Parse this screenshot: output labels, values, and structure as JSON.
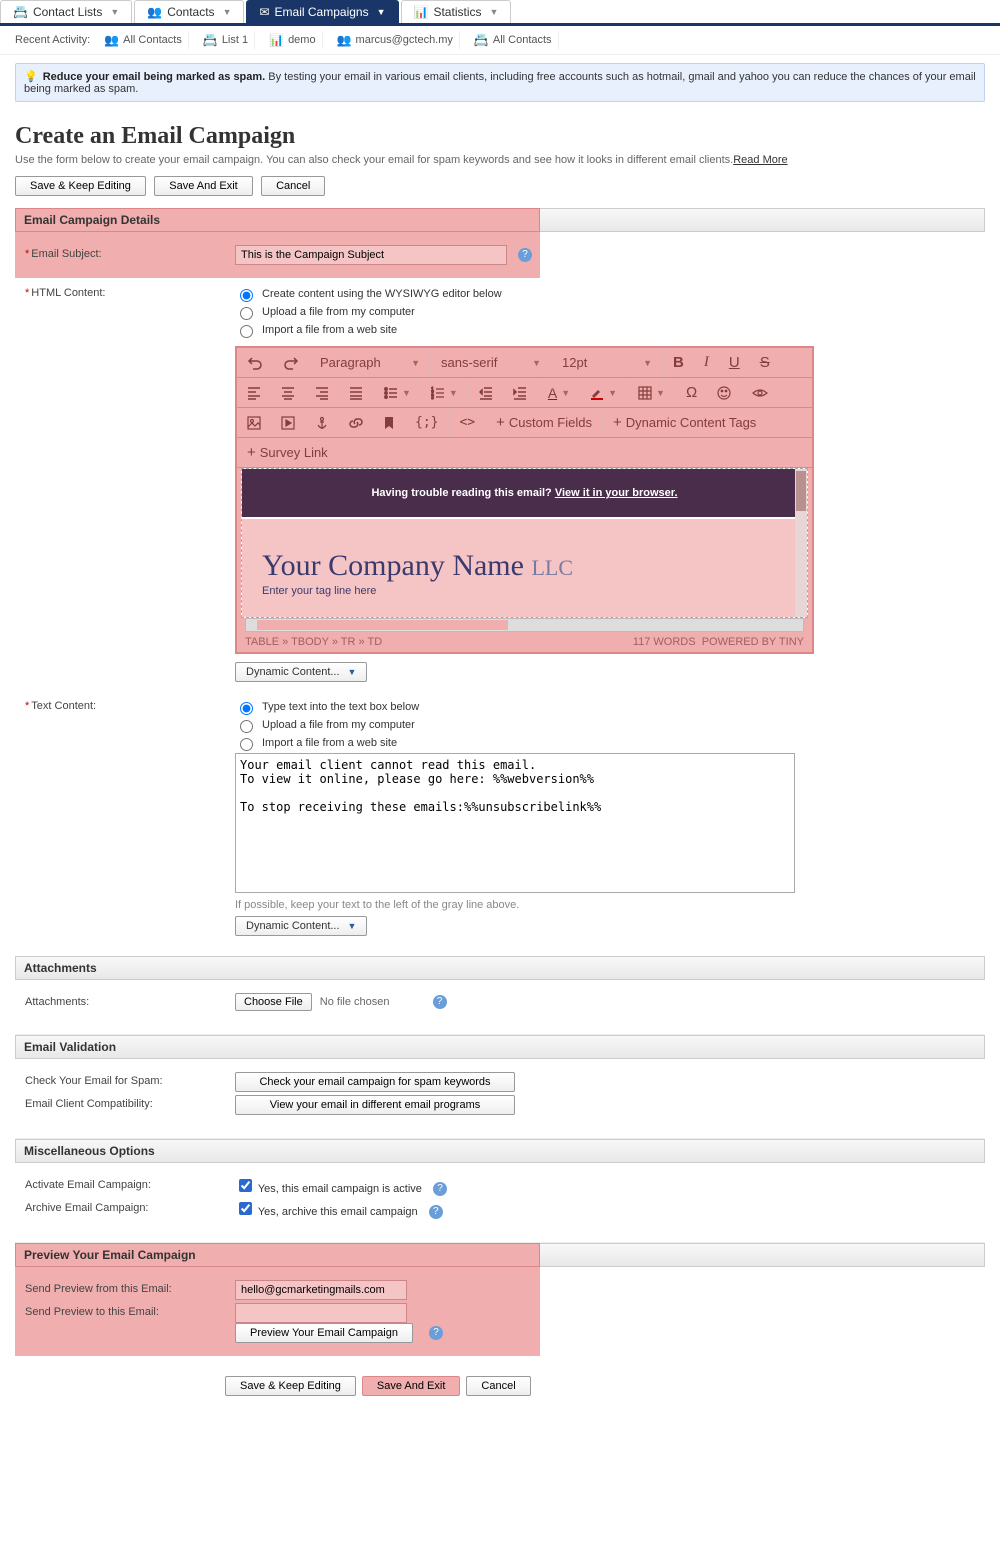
{
  "nav": {
    "tabs": [
      {
        "label": "Contact Lists",
        "active": false
      },
      {
        "label": "Contacts",
        "active": false
      },
      {
        "label": "Email Campaigns",
        "active": true
      },
      {
        "label": "Statistics",
        "active": false
      }
    ]
  },
  "recent": {
    "label": "Recent Activity:",
    "items": [
      "All Contacts",
      "List 1",
      "demo",
      "marcus@gctech.my",
      "All Contacts"
    ]
  },
  "tip": {
    "bold": "Reduce your email being marked as spam.",
    "text": " By testing your email in various email clients, including free accounts such as hotmail, gmail and yahoo you can reduce the chances of your email being marked as spam."
  },
  "page": {
    "title": "Create an Email Campaign",
    "sub": "Use the form below to create your email campaign. You can also check your email for spam keywords and see how it looks in different email clients.",
    "readmore": "Read More",
    "save_keep": "Save & Keep Editing",
    "save_exit": "Save And Exit",
    "cancel": "Cancel"
  },
  "details": {
    "header": "Email Campaign Details",
    "subject_label": "Email Subject:",
    "subject_value": "This is the Campaign Subject",
    "html_label": "HTML Content:",
    "html_options": [
      "Create content using the WYSIWYG editor below",
      "Upload a file from my computer",
      "Import a file from a web site"
    ]
  },
  "editor": {
    "format": "Paragraph",
    "font": "sans-serif",
    "size": "12pt",
    "custom_fields": "Custom Fields",
    "dyn_tags": "Dynamic Content Tags",
    "survey": "Survey Link",
    "trouble": "Having trouble reading this email? ",
    "viewlink": "View it in your browser.",
    "company": "Your Company Name",
    "llc": "LLC",
    "tagline": "Enter your tag line here",
    "path": "TABLE » TBODY » TR » TD",
    "wordcount": "117 WORDS",
    "powered": "POWERED BY TINY",
    "dyn_btn": "Dynamic Content..."
  },
  "textcontent": {
    "label": "Text Content:",
    "options": [
      "Type text into the text box below",
      "Upload a file from my computer",
      "Import a file from a web site"
    ],
    "value": "Your email client cannot read this email.\nTo view it online, please go here: %%webversion%%\n\nTo stop receiving these emails:%%unsubscribelink%%",
    "note": "If possible, keep your text to the left of the gray line above.",
    "dyn_btn": "Dynamic Content..."
  },
  "attachments": {
    "header": "Attachments",
    "label": "Attachments:",
    "choose": "Choose File",
    "nofile": "No file chosen"
  },
  "validation": {
    "header": "Email Validation",
    "spam_label": "Check Your Email for Spam:",
    "spam_btn": "Check your email campaign for spam keywords",
    "compat_label": "Email Client Compatibility:",
    "compat_btn": "View your email in different email programs"
  },
  "misc": {
    "header": "Miscellaneous Options",
    "activate_label": "Activate Email Campaign:",
    "activate_text": "Yes, this email campaign is active",
    "archive_label": "Archive Email Campaign:",
    "archive_text": "Yes, archive this email campaign"
  },
  "preview": {
    "header": "Preview Your Email Campaign",
    "from_label": "Send Preview from this Email:",
    "from_value": "hello@gcmarketingmails.com",
    "to_label": "Send Preview to this Email:",
    "to_value": "",
    "btn": "Preview Your Email Campaign"
  }
}
